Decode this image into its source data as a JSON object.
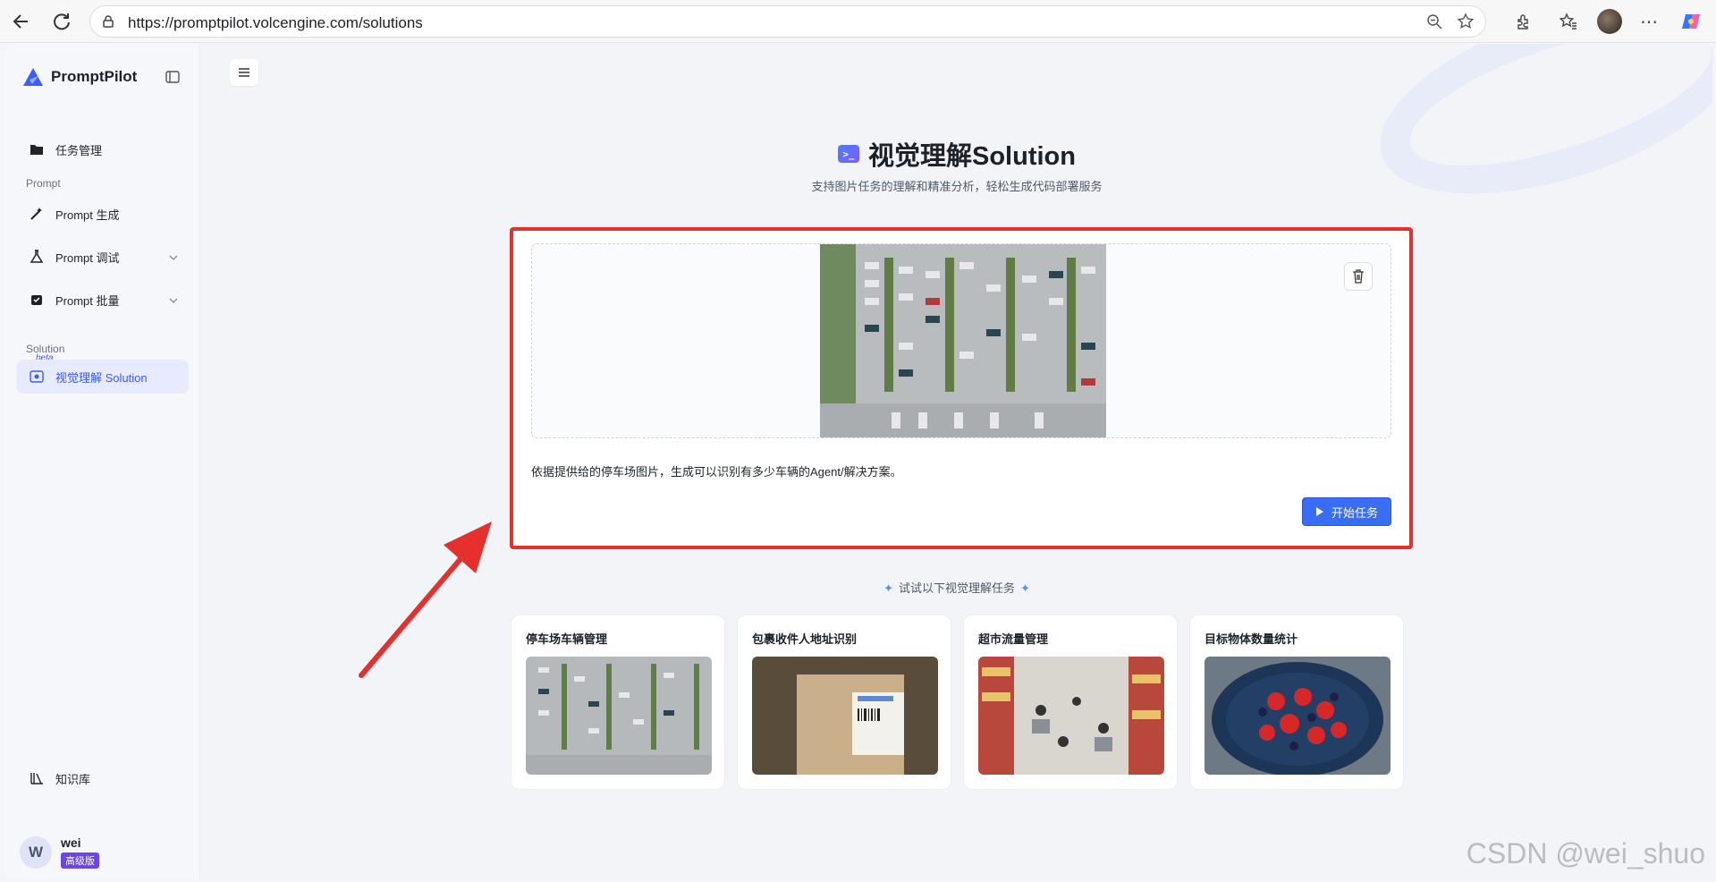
{
  "browser": {
    "url": "https://promptpilot.volcengine.com/solutions"
  },
  "sidebar": {
    "brand": "PromptPilot",
    "task_mgmt": "任务管理",
    "section_prompt": "Prompt",
    "items": [
      {
        "label": "Prompt 生成"
      },
      {
        "label": "Prompt 调试"
      },
      {
        "label": "Prompt 批量"
      }
    ],
    "section_solution": "Solution",
    "beta": "beta",
    "solution_item": "视觉理解 Solution",
    "knowledge": "知识库",
    "user": {
      "initial": "W",
      "name": "wei",
      "plan": "高级版"
    }
  },
  "main": {
    "title": "视觉理解Solution",
    "subtitle": "支持图片任务的理解和精准分析，轻松生成代码部署服务",
    "prompt_text": "依据提供给的停车场图片，生成可以识别有多少车辆的Agent/解决方案。",
    "start_label": "开始任务",
    "try_label": "试试以下视觉理解任务"
  },
  "cards": [
    {
      "title": "停车场车辆管理"
    },
    {
      "title": "包裹收件人地址识别"
    },
    {
      "title": "超市流量管理"
    },
    {
      "title": "目标物体数量统计"
    }
  ],
  "watermark": "CSDN @wei_shuo",
  "colors": {
    "accent": "#3a6df6",
    "highlight": "#e6302d",
    "active_bg": "#e8ebfe"
  }
}
